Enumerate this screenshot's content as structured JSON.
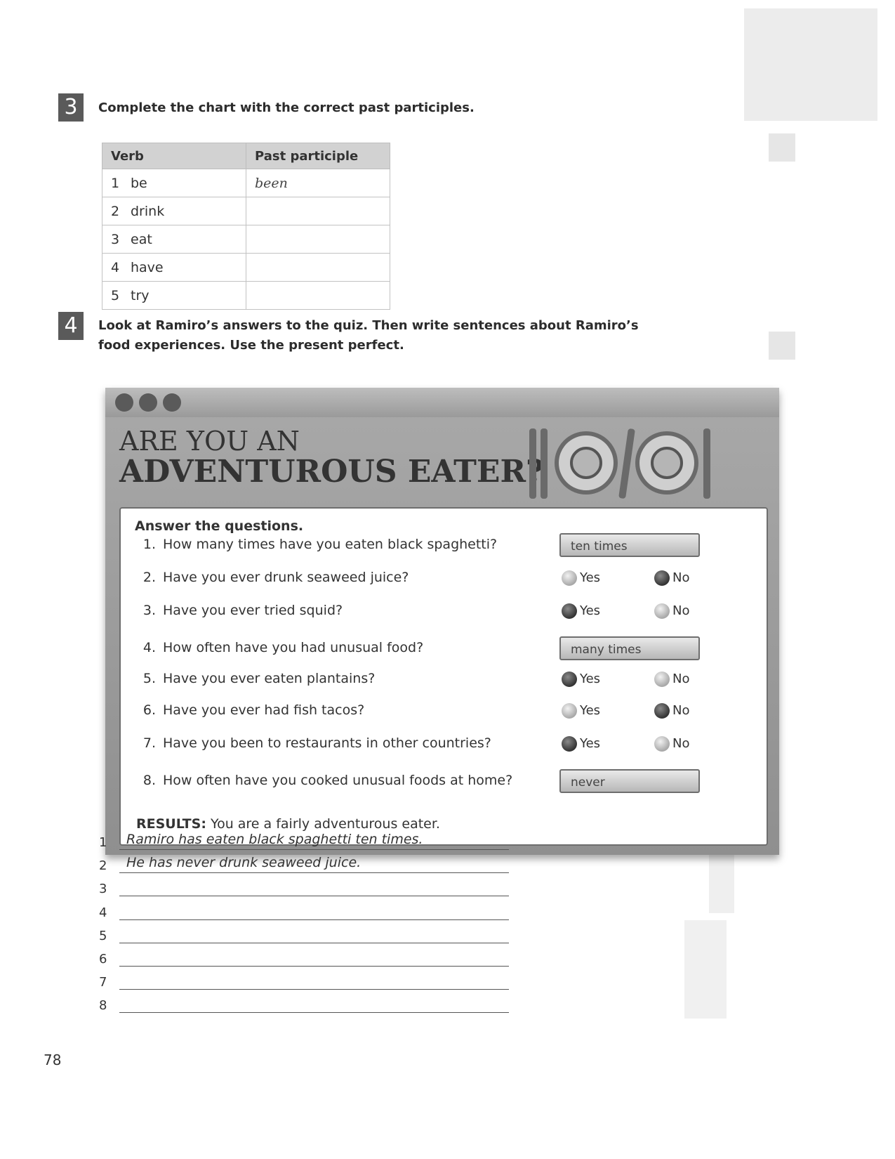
{
  "section3": {
    "number": "3",
    "instruction": "Complete the chart with the correct past participles.",
    "headers": [
      "Verb",
      "Past participle"
    ],
    "rows": [
      {
        "num": "1",
        "verb": "be",
        "participle": "been"
      },
      {
        "num": "2",
        "verb": "drink",
        "participle": ""
      },
      {
        "num": "3",
        "verb": "eat",
        "participle": ""
      },
      {
        "num": "4",
        "verb": "have",
        "participle": ""
      },
      {
        "num": "5",
        "verb": "try",
        "participle": ""
      }
    ]
  },
  "section4": {
    "number": "4",
    "instruction_line1": "Look at Ramiro’s answers to the quiz. Then write sentences about Ramiro’s",
    "instruction_line2": "food experiences. Use the present perfect."
  },
  "quiz": {
    "title_line1": "ARE YOU AN",
    "title_line2": "ADVENTUROUS EATER?",
    "prompt": "Answer the questions.",
    "questions": [
      {
        "num": "1.",
        "text": "How many times have you eaten black spaghetti?",
        "answer": "ten times"
      },
      {
        "num": "2.",
        "text": "Have you ever drunk seaweed juice?",
        "yes": "Yes",
        "no": "No",
        "selected": "No"
      },
      {
        "num": "3.",
        "text": "Have you ever tried squid?",
        "yes": "Yes",
        "no": "No",
        "selected": "Yes"
      },
      {
        "num": "4.",
        "text": "How often have you had unusual food?",
        "answer": "many times"
      },
      {
        "num": "5.",
        "text": "Have you ever eaten plantains?",
        "yes": "Yes",
        "no": "No",
        "selected": "Yes"
      },
      {
        "num": "6.",
        "text": "Have you ever had fish tacos?",
        "yes": "Yes",
        "no": "No",
        "selected": "No"
      },
      {
        "num": "7.",
        "text": "Have you been to restaurants in other countries?",
        "yes": "Yes",
        "no": "No",
        "selected": "Yes"
      },
      {
        "num": "8.",
        "text": "How often have you cooked unusual foods at home?",
        "answer": "never"
      }
    ],
    "results_label": "RESULTS:",
    "results_text": "You are a fairly adventurous eater."
  },
  "answers": [
    {
      "num": "1",
      "text": "Ramiro has eaten black spaghetti ten times."
    },
    {
      "num": "2",
      "text": "He has never drunk seaweed juice."
    },
    {
      "num": "3",
      "text": ""
    },
    {
      "num": "4",
      "text": ""
    },
    {
      "num": "5",
      "text": ""
    },
    {
      "num": "6",
      "text": ""
    },
    {
      "num": "7",
      "text": ""
    },
    {
      "num": "8",
      "text": ""
    }
  ],
  "page_number": "78"
}
